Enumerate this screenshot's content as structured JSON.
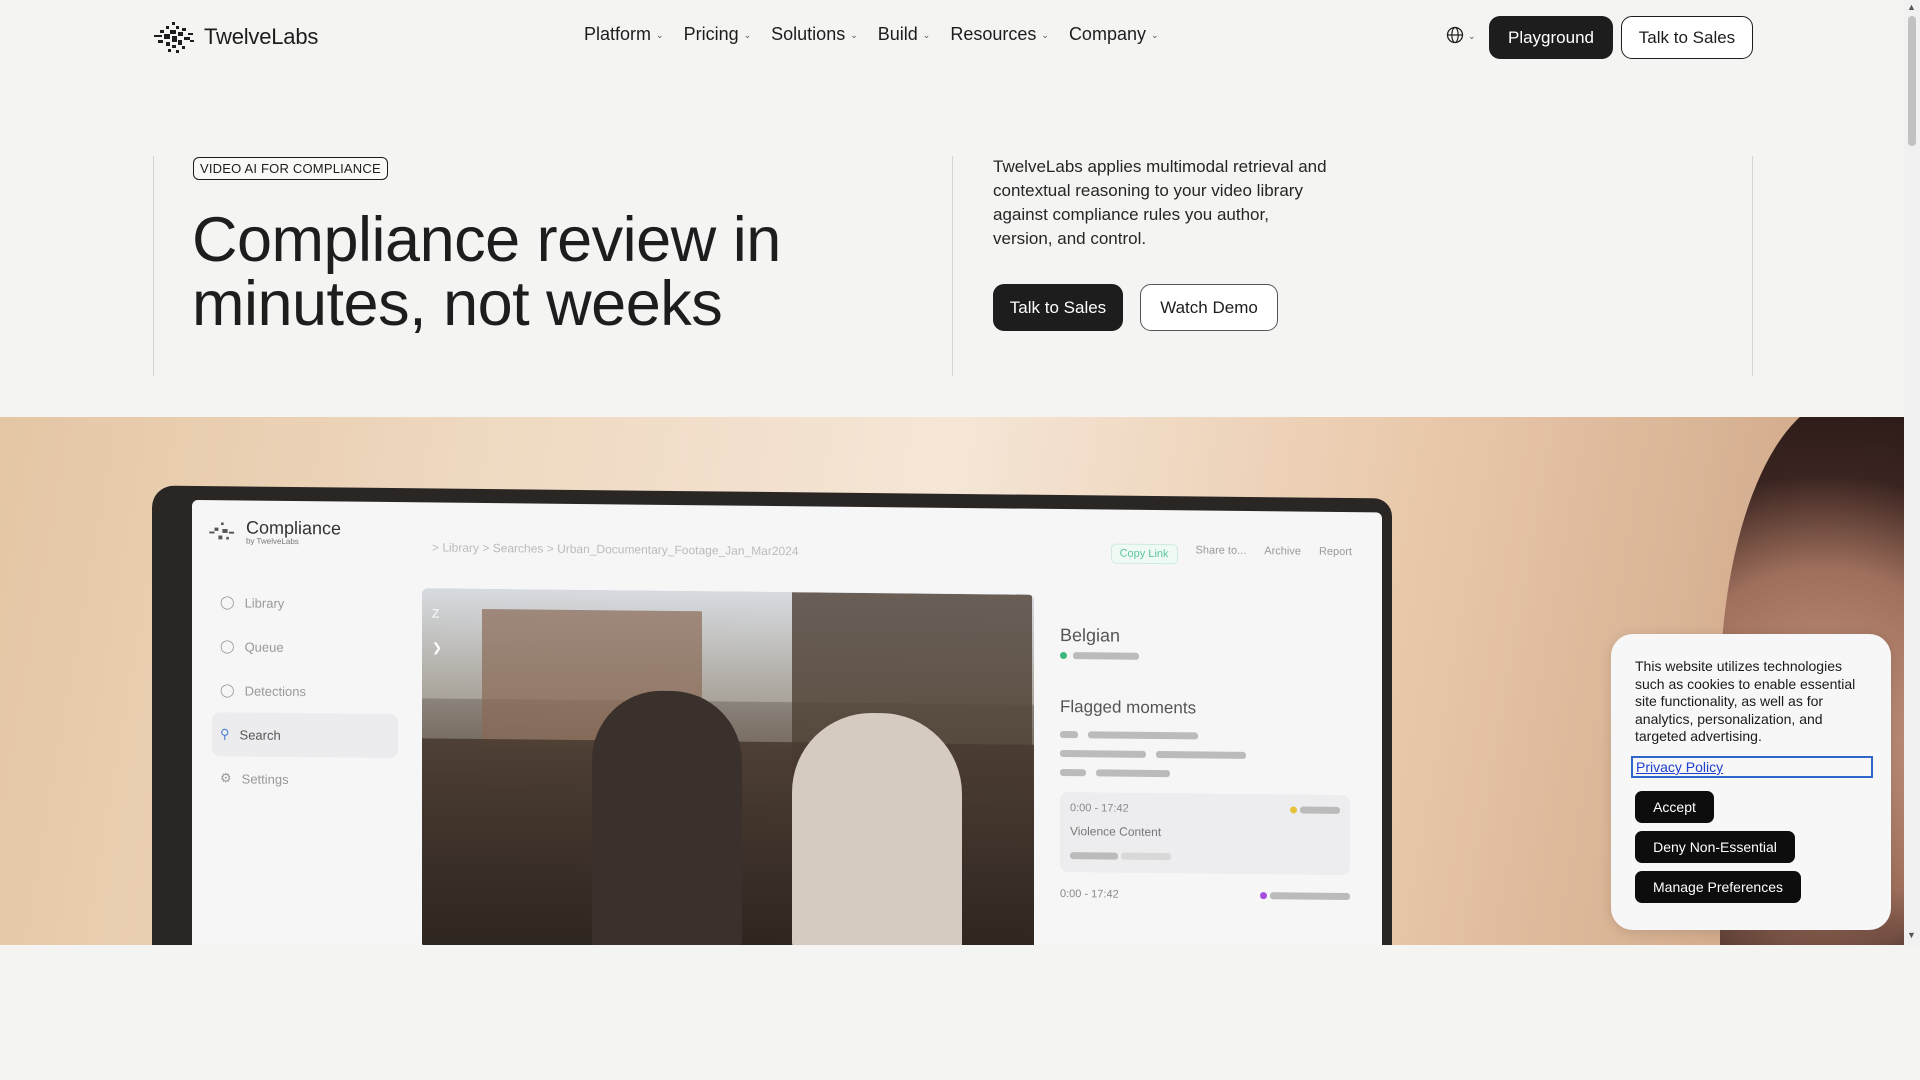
{
  "nav": {
    "brand": "TwelveLabs",
    "menu": [
      {
        "label": "Platform"
      },
      {
        "label": "Pricing"
      },
      {
        "label": "Solutions"
      },
      {
        "label": "Build"
      },
      {
        "label": "Resources"
      },
      {
        "label": "Company"
      }
    ],
    "playground_label": "Playground",
    "talk_sales_label": "Talk to Sales"
  },
  "hero": {
    "badge": "VIDEO AI FOR COMPLIANCE",
    "headline": "Compliance review in minutes, not weeks",
    "description": "TwelveLabs applies multimodal retrieval and contextual reasoning to your video library against compliance rules you author, version, and control.",
    "primary_button": "Talk to Sales",
    "secondary_button": "Watch Demo"
  },
  "app_mock": {
    "title": "Compliance",
    "subtitle": "by TwelveLabs",
    "breadcrumb": ">  Library  >  Searches  >  Urban_Documentary_Footage_Jan_Mar2024",
    "actions": [
      "Copy Link",
      "Share to...",
      "Archive",
      "Report"
    ],
    "sidebar": [
      "Library",
      "Queue",
      "Detections",
      "Search",
      "Settings"
    ],
    "panel_title": "Belgian",
    "flagged_title": "Flagged moments",
    "timestamp_1": "0:00 - 17:42",
    "card_label": "Violence Content",
    "timestamp_2": "0:00 - 17:42"
  },
  "cookie": {
    "text": "This website utilizes technologies such as cookies to enable essential site functionality, as well as for analytics, personalization, and targeted advertising.",
    "privacy_link": "Privacy Policy",
    "accept": "Accept",
    "deny": "Deny Non-Essential",
    "manage": "Manage Preferences"
  },
  "icons": {
    "logo": "twelvelabs-logo-icon",
    "chevron": "chevron-down-icon",
    "globe": "globe-icon"
  },
  "colors": {
    "dark": "#1d1d1d",
    "background": "#f4f4f3",
    "link": "#1e3fd0",
    "accent_green": "#5cc59a"
  }
}
